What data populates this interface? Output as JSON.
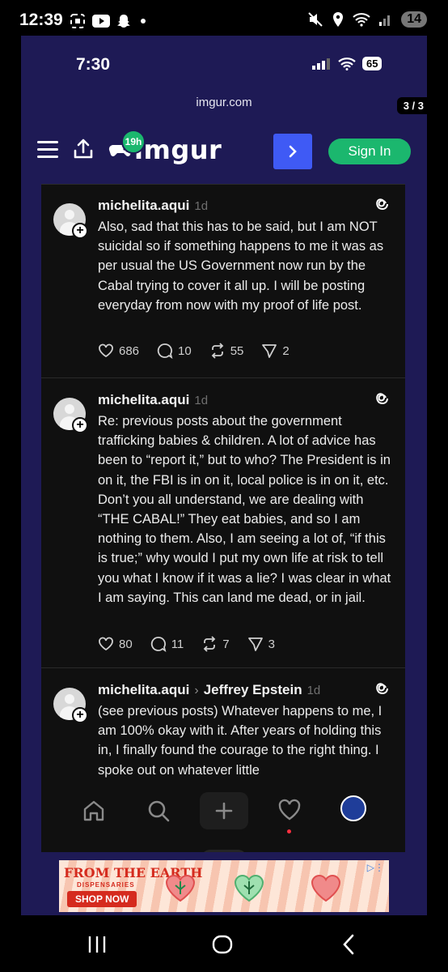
{
  "android_status": {
    "time": "12:39",
    "battery": "14"
  },
  "ios_status": {
    "time": "7:30",
    "battery": "65"
  },
  "browser": {
    "url": "imgur.com",
    "page_counter": "3 / 3"
  },
  "imgur": {
    "logo": "imgur",
    "badge": "19h",
    "signin_label": "Sign In"
  },
  "posts": [
    {
      "username": "michelita.aqui",
      "age": "1d",
      "text": "Also, sad that this has to be said, but I am NOT suicidal so if something happens to me it was as per usual the US Government now run by the Cabal trying to cover it all up. I will be posting everyday from now with my proof of life post.",
      "likes": "686",
      "comments": "10",
      "reposts": "55",
      "shares": "2"
    },
    {
      "username": "michelita.aqui",
      "age": "1d",
      "text": "Re: previous posts about the government trafficking babies & children. A lot of advice has been to “report it,” but to who? The President is in on it, the FBI is in on it, local police is in on it, etc. Don’t you all understand, we are dealing with “THE CABAL!” They eat babies, and so I am nothing to them. Also, I am seeing a lot of, “if this is true;” why would I put my own life at risk to tell you what I know if it was a lie? I was clear in what I am saying. This can land me dead, or in jail.",
      "likes": "80",
      "comments": "11",
      "reposts": "7",
      "shares": "3"
    },
    {
      "username": "michelita.aqui",
      "reply_to": "Jeffrey Epstein",
      "age": "1d",
      "text": "(see previous posts) Whatever happens to me, I am 100% okay with it.  After years of holding this in, I finally found the courage to the right thing. I spoke out on whatever little"
    }
  ],
  "ad": {
    "brand": "FROM THE EARTH",
    "sub": "DISPENSARIES",
    "cta": "SHOP NOW"
  },
  "colors": {
    "imgur_green": "#1bb76e",
    "imgur_blue": "#3f5af5",
    "frame_bg": "#1e1a55",
    "threads_bg": "#101010"
  }
}
